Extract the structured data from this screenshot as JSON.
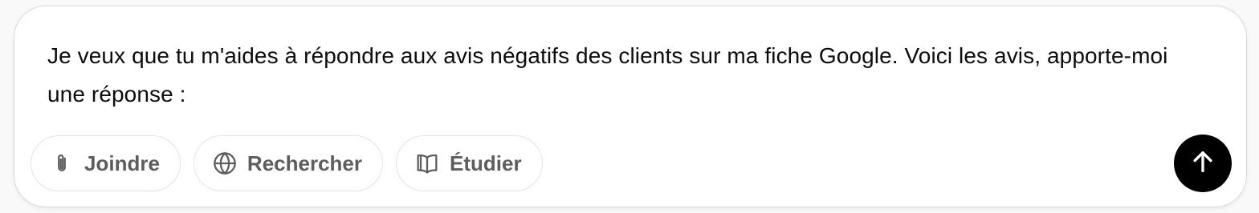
{
  "composer": {
    "prompt_text": "Je veux que tu m'aides à répondre aux avis négatifs des clients sur ma fiche Google. Voici les avis, apporte-moi une réponse :"
  },
  "toolbar": {
    "buttons": [
      {
        "label": "Joindre",
        "icon": "paperclip-icon"
      },
      {
        "label": "Rechercher",
        "icon": "globe-icon"
      },
      {
        "label": "Étudier",
        "icon": "book-icon"
      }
    ]
  },
  "send": {
    "icon": "arrow-up-icon",
    "background_color": "#000000"
  }
}
